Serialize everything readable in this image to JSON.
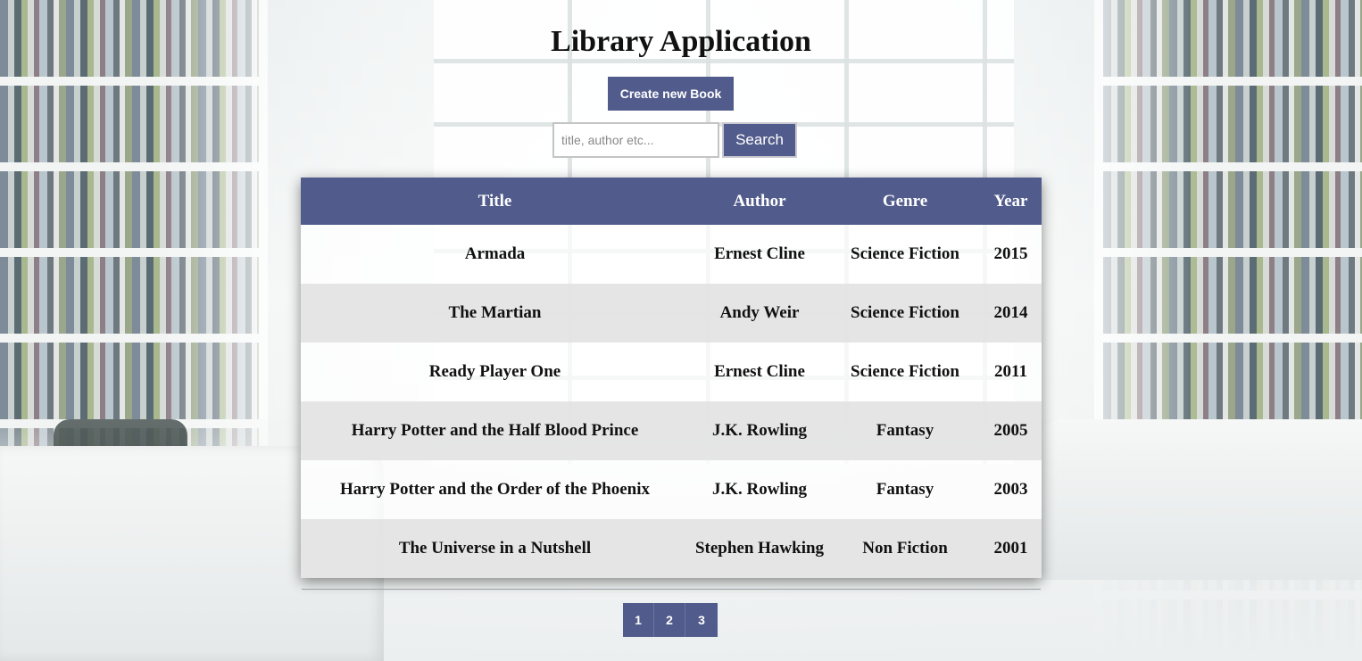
{
  "header": {
    "title": "Library Application",
    "create_button_label": "Create new Book"
  },
  "search": {
    "placeholder": "title, author etc...",
    "value": "",
    "button_label": "Search"
  },
  "table": {
    "columns": [
      "Title",
      "Author",
      "Genre",
      "Year"
    ],
    "rows": [
      {
        "title": "Armada",
        "author": "Ernest Cline",
        "genre": "Science Fiction",
        "year": "2015"
      },
      {
        "title": "The Martian",
        "author": "Andy Weir",
        "genre": "Science Fiction",
        "year": "2014"
      },
      {
        "title": "Ready Player One",
        "author": "Ernest Cline",
        "genre": "Science Fiction",
        "year": "2011"
      },
      {
        "title": "Harry Potter and the Half Blood Prince",
        "author": "J.K. Rowling",
        "genre": "Fantasy",
        "year": "2005"
      },
      {
        "title": "Harry Potter and the Order of the Phoenix",
        "author": "J.K. Rowling",
        "genre": "Fantasy",
        "year": "2003"
      },
      {
        "title": "The Universe in a Nutshell",
        "author": "Stephen Hawking",
        "genre": "Non Fiction",
        "year": "2001"
      }
    ]
  },
  "pagination": {
    "pages": [
      "1",
      "2",
      "3"
    ]
  },
  "colors": {
    "accent": "#525c8c",
    "row_alt": "#e4e4e4"
  }
}
